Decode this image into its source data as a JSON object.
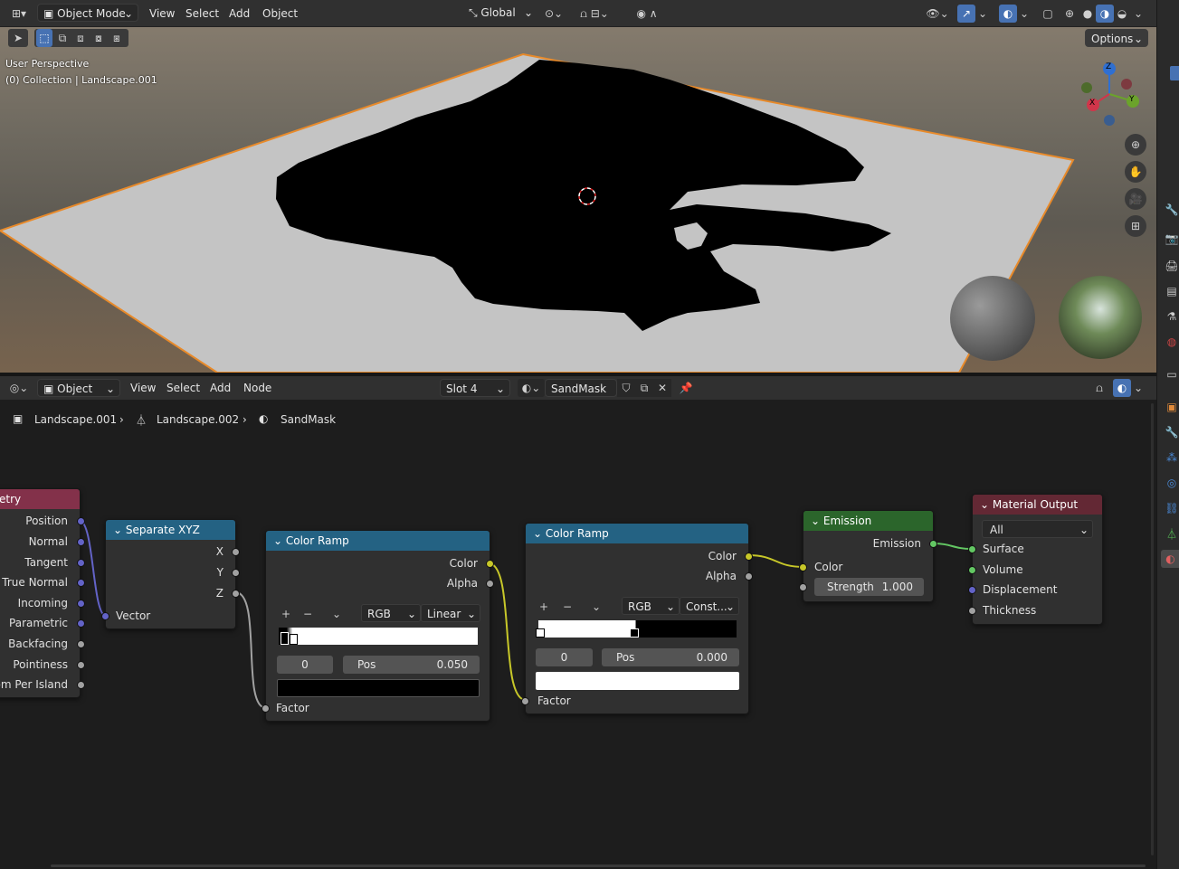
{
  "viewport": {
    "header": {
      "mode": "Object Mode",
      "menus": [
        "View",
        "Select",
        "Add",
        "Object"
      ],
      "orientation": "Global",
      "options_label": "Options"
    },
    "overlay": {
      "view_name": "User Perspective",
      "collection": "(0) Collection | Landscape.001"
    },
    "gizmo": {
      "z": "Z",
      "y": "Y",
      "x": "X"
    }
  },
  "node_editor": {
    "header": {
      "editor_type": "Object",
      "menus": [
        "View",
        "Select",
        "Add",
        "Node"
      ],
      "slot": "Slot 4",
      "material": "SandMask"
    },
    "breadcrumb": [
      "Landscape.001",
      "Landscape.002",
      "SandMask"
    ],
    "nodes": {
      "geometry": {
        "title": "etry",
        "outputs": [
          "Position",
          "Normal",
          "Tangent",
          "True Normal",
          "Incoming",
          "Parametric",
          "Backfacing",
          "Pointiness",
          "dom Per Island"
        ]
      },
      "separate_xyz": {
        "title": "Separate XYZ",
        "outputs": [
          "X",
          "Y",
          "Z"
        ],
        "input": "Vector"
      },
      "color_ramp_1": {
        "title": "Color Ramp",
        "out_color": "Color",
        "out_alpha": "Alpha",
        "color_mode": "RGB",
        "interpolation": "Linear",
        "stop_index": "0",
        "pos_label": "Pos",
        "pos_value": "0.050",
        "input": "Factor",
        "stop_color": "#000000"
      },
      "color_ramp_2": {
        "title": "Color Ramp",
        "out_color": "Color",
        "out_alpha": "Alpha",
        "color_mode": "RGB",
        "interpolation": "Const...",
        "stop_index": "0",
        "pos_label": "Pos",
        "pos_value": "0.000",
        "input": "Factor",
        "stop_color": "#ffffff"
      },
      "emission": {
        "title": "Emission",
        "output": "Emission",
        "in_color": "Color",
        "strength_label": "Strength",
        "strength_value": "1.000"
      },
      "material_output": {
        "title": "Material Output",
        "target": "All",
        "inputs": [
          "Surface",
          "Volume",
          "Displacement",
          "Thickness"
        ]
      }
    }
  },
  "colors": {
    "accent": "#4772b3",
    "selection_outline": "#e88a2a",
    "geometry_header": "#83314a",
    "converter_header": "#246283",
    "shader_header": "#2b652b",
    "output_header": "#632834",
    "socket_vector": "#6363c7",
    "socket_float": "#a1a1a1",
    "socket_color": "#c7c729",
    "socket_shader": "#63c763"
  }
}
